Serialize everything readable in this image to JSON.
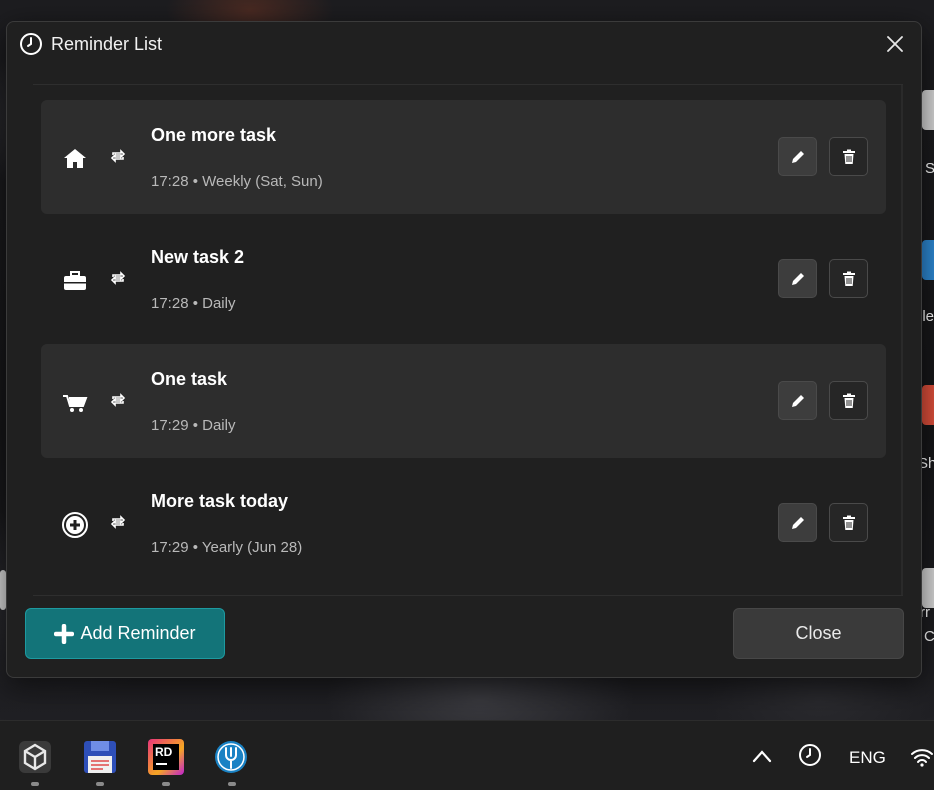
{
  "window": {
    "title": "Reminder List",
    "close_icon": "close-icon",
    "title_icon": "clock-icon"
  },
  "reminders": [
    {
      "title": "One more task",
      "subtitle": "17:28 • Weekly (Sat, Sun)",
      "category_icon": "home-icon",
      "repeat_icon": "repeat-icon",
      "highlighted": true
    },
    {
      "title": "New task 2",
      "subtitle": "17:28 • Daily",
      "category_icon": "briefcase-icon",
      "repeat_icon": "repeat-icon",
      "highlighted": false
    },
    {
      "title": "One task",
      "subtitle": "17:29 • Daily",
      "category_icon": "cart-icon",
      "repeat_icon": "repeat-icon",
      "highlighted": true
    },
    {
      "title": "More task today",
      "subtitle": "17:29 • Yearly (Jun 28)",
      "category_icon": "plus-circle-icon",
      "repeat_icon": "repeat-icon",
      "highlighted": false
    }
  ],
  "footer": {
    "add_label": "Add Reminder",
    "close_label": "Close"
  },
  "taskbar": {
    "apps": [
      "unity-icon",
      "save-icon",
      "rider-icon",
      "fork-icon"
    ],
    "rider_badge": "RD",
    "language": "ENG"
  },
  "desktop": {
    "labels": [
      "S",
      "ele",
      "Sh",
      "rr",
      "C"
    ]
  },
  "colors": {
    "accent": "#137479",
    "dialog_bg": "#202020",
    "row_highlight": "#2d2d2d"
  }
}
